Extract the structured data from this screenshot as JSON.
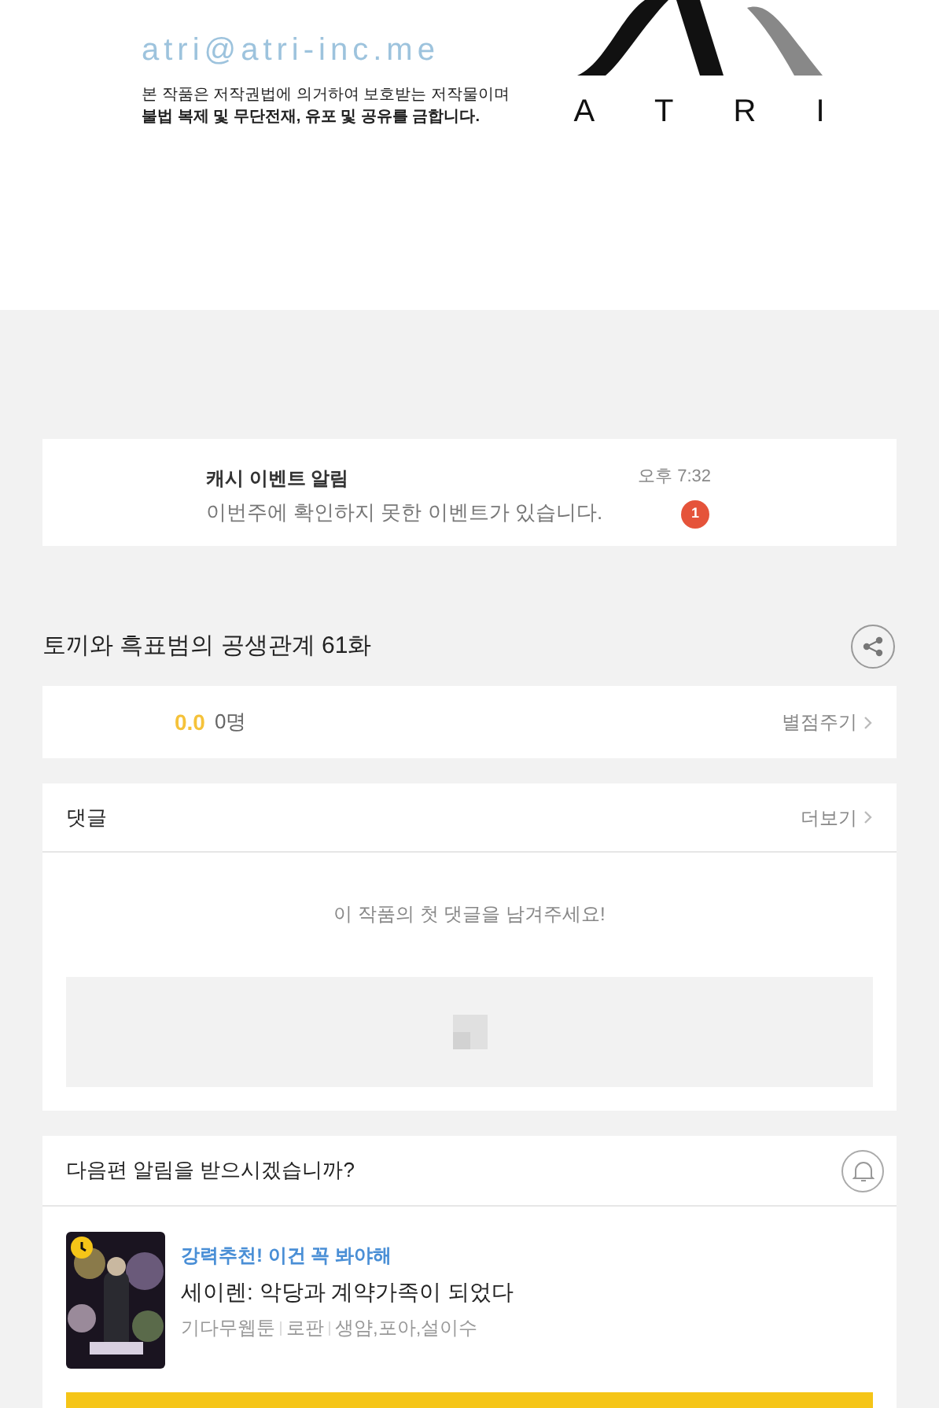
{
  "footer_image": {
    "email": "atri@atri-inc.me",
    "notice": [
      "본 작품은 저작권법에 의거하여 보호받는 저작물이며",
      "불법 복제 및 무단전재, 유포 및 공유를 금합니다."
    ],
    "logo_letters": [
      "A",
      "T",
      "R",
      "I"
    ]
  },
  "notification": {
    "title": "캐시 이벤트 알림",
    "message": "이번주에 확인하지 못한 이벤트가 있습니다.",
    "time": "오후 7:32",
    "badge": "1"
  },
  "episode": {
    "title": "토끼와 흑표범의 공생관계 61화"
  },
  "rating": {
    "score": "0.0",
    "count": "0명",
    "action": "별점주기"
  },
  "comments": {
    "title": "댓글",
    "more": "더보기",
    "empty": "이 작품의 첫 댓글을 남겨주세요!"
  },
  "next_alert": {
    "question": "다음편 알림을 받으시겠습니까?"
  },
  "recommendation": {
    "tag": "강력추천! 이건 꼭 봐야해",
    "title": "세이렌: 악당과 계약가족이 되었다",
    "meta": [
      "기다무웹툰",
      "로판",
      "생얌,포아,설이수"
    ]
  }
}
